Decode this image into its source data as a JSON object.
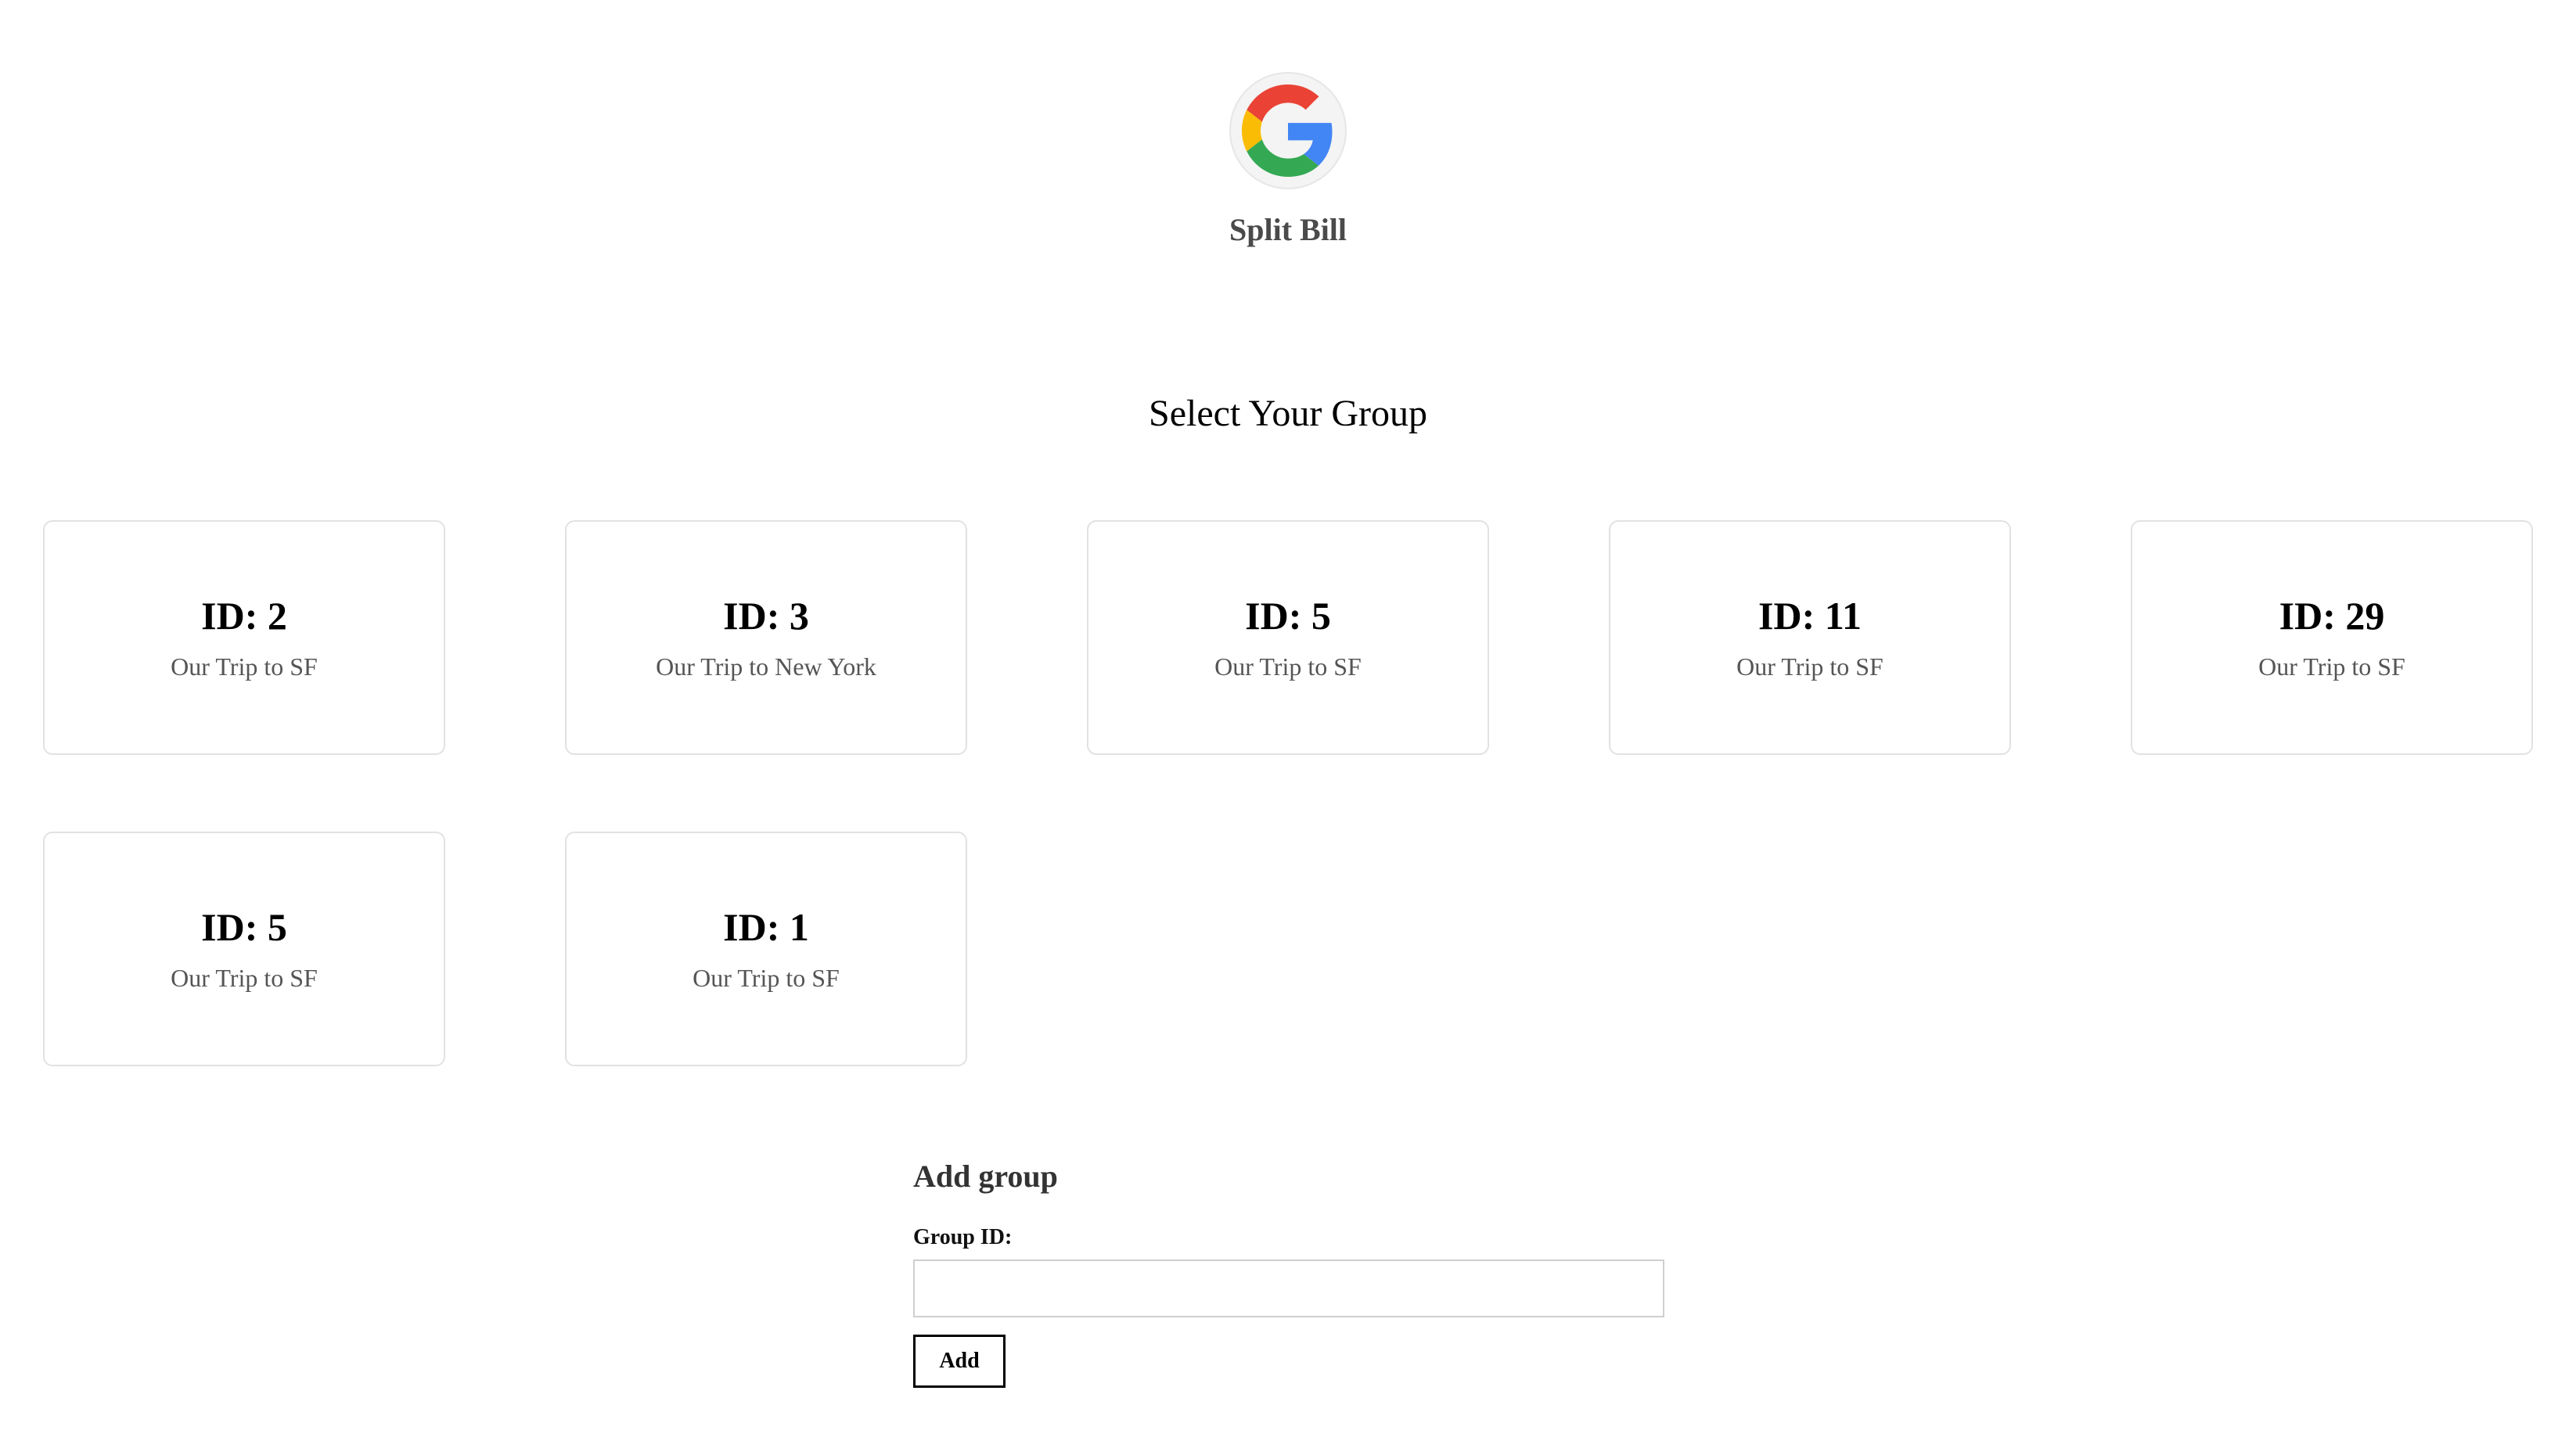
{
  "app": {
    "name": "Split Bill",
    "logo_icon": "google-g-icon"
  },
  "main": {
    "title": "Select Your Group",
    "groups": [
      {
        "id_label": "ID: 2",
        "name": "Our Trip to SF"
      },
      {
        "id_label": "ID: 3",
        "name": "Our Trip to New York"
      },
      {
        "id_label": "ID: 5",
        "name": "Our Trip to SF"
      },
      {
        "id_label": "ID: 11",
        "name": "Our Trip to SF"
      },
      {
        "id_label": "ID: 29",
        "name": "Our Trip to SF"
      },
      {
        "id_label": "ID: 5",
        "name": "Our Trip to SF"
      },
      {
        "id_label": "ID: 1",
        "name": "Our Trip to SF"
      }
    ]
  },
  "add_group": {
    "title": "Add group",
    "field_label": "Group ID:",
    "field_value": "",
    "button_label": "Add"
  },
  "colors": {
    "google_red": "#EA4335",
    "google_yellow": "#FBBC05",
    "google_green": "#34A853",
    "google_blue": "#4285F4",
    "card_border": "#e2e2e2"
  }
}
